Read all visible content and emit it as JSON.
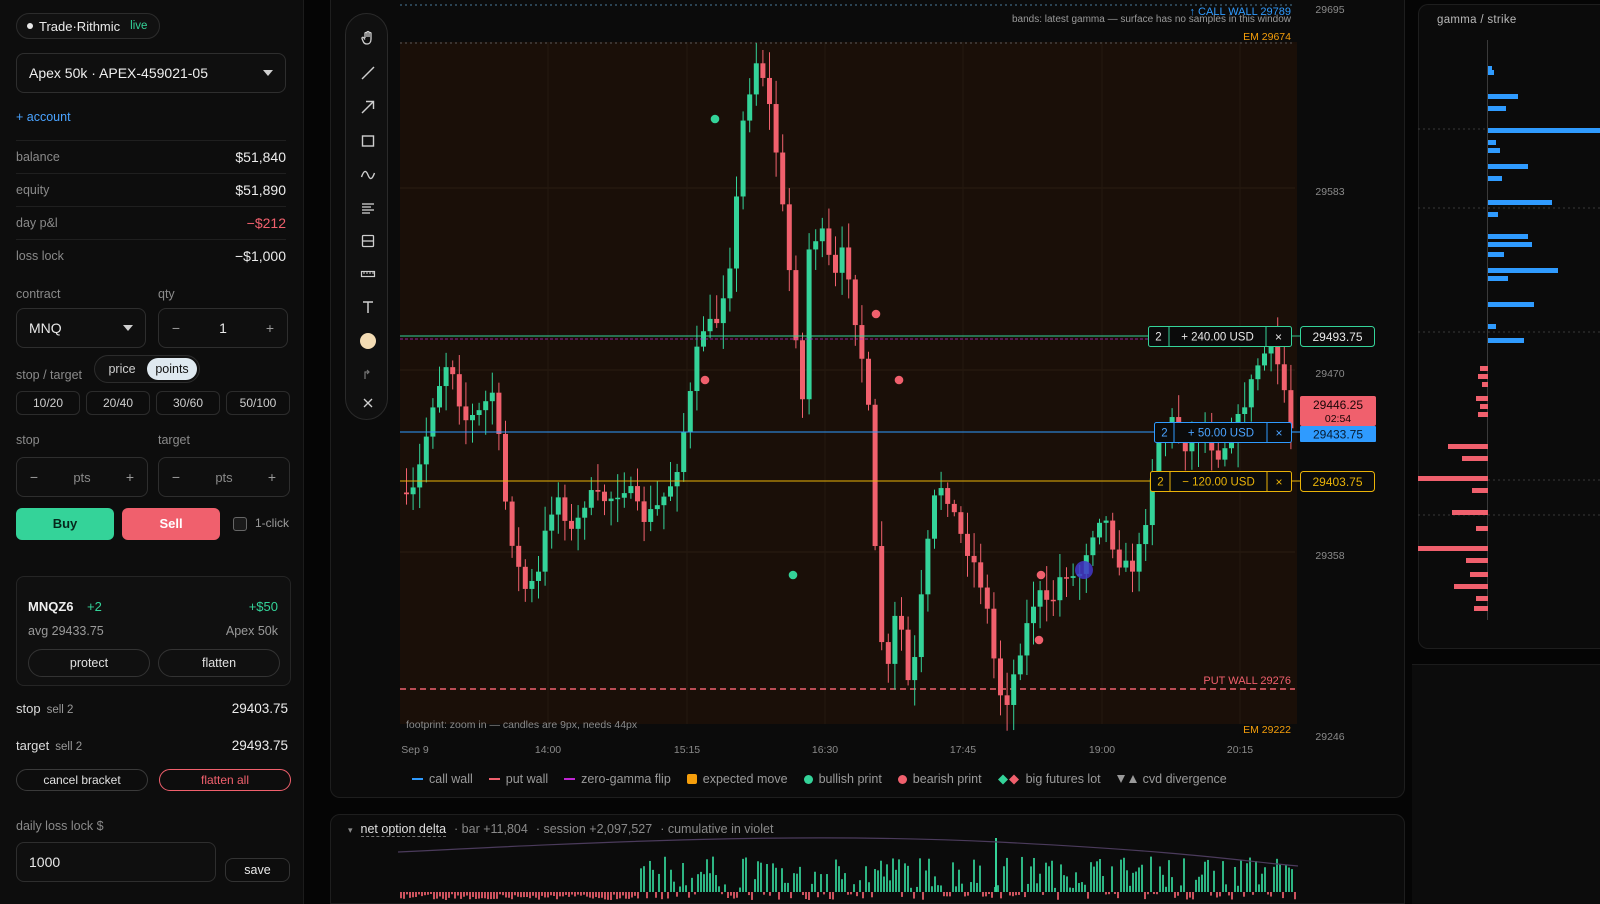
{
  "account_panel": {
    "broker": "Trade·Rithmic",
    "status": "live",
    "account_selected": "Apex 50k · APEX-459021-05",
    "add_account": "+ account",
    "stats": [
      {
        "label": "balance",
        "value": "$51,840",
        "negative": false
      },
      {
        "label": "equity",
        "value": "$51,890",
        "negative": false
      },
      {
        "label": "day p&l",
        "value": "−$212",
        "negative": true
      },
      {
        "label": "loss lock",
        "value": "−$1,000",
        "negative": false
      }
    ]
  },
  "order_ticket": {
    "contract_label": "contract",
    "contract_value": "MNQ",
    "qty_label": "qty",
    "qty_value": "1",
    "stop_target_label": "stop / target",
    "mode_price": "price",
    "mode_points": "points",
    "presets": [
      "10/20",
      "20/40",
      "30/60",
      "50/100"
    ],
    "stop_label": "stop",
    "target_label": "target",
    "stop_placeholder": "pts",
    "target_placeholder": "pts",
    "buy": "Buy",
    "sell": "Sell",
    "one_click": "1-click"
  },
  "position": {
    "symbol": "MNQZ6",
    "qty": "+2",
    "pnl": "+$50",
    "avg": "avg 29433.75",
    "account": "Apex 50k",
    "protect": "protect",
    "flatten": "flatten"
  },
  "orders": [
    {
      "kind": "stop",
      "side": "sell 2",
      "price": "29403.75"
    },
    {
      "kind": "target",
      "side": "sell 2",
      "price": "29493.75"
    }
  ],
  "order_actions": {
    "cancel_bracket": "cancel bracket",
    "flatten_all": "flatten all"
  },
  "daily_loss": {
    "label": "daily loss lock $",
    "value": "1000",
    "save": "save"
  },
  "tools": [
    "hand-icon",
    "line-icon",
    "arrow-icon",
    "rectangle-icon",
    "curve-icon",
    "text-lines-icon",
    "panel-icon",
    "ruler-icon",
    "text-icon",
    "color-icon",
    "undo-icon",
    "close-icon"
  ],
  "chart": {
    "status_note": "bands: latest gamma — surface has no samples in this window",
    "footprint_note": "footprint: zoom in — candles are 9px, needs 44px",
    "call_wall_label": "↑ CALL WALL 29789",
    "em_high_label": "EM 29674",
    "put_wall_label": "PUT WALL 29276",
    "em_low_label": "EM 29222",
    "price_ticks": [
      "29695",
      "29583",
      "29470",
      "29358",
      "29246"
    ],
    "time_ticks": [
      "Sep 9",
      "14:00",
      "15:15",
      "16:30",
      "17:45",
      "19:00",
      "20:15"
    ],
    "current_price": "29446.25",
    "countdown": "02:54",
    "orders": [
      {
        "qty": "2",
        "pnl": "+ 240.00 USD",
        "price": "29493.75",
        "color": "#34d399"
      },
      {
        "qty": "2",
        "pnl": "+ 50.00 USD",
        "price": "29433.75",
        "color": "#2f9bff"
      },
      {
        "qty": "2",
        "pnl": "− 120.00 USD",
        "price": "29403.75",
        "color": "#eab308"
      }
    ],
    "close_symbol": "×"
  },
  "legend": [
    {
      "label": "call wall",
      "kind": "line",
      "color": "#2f9bff"
    },
    {
      "label": "put wall",
      "kind": "line",
      "color": "#f0606d"
    },
    {
      "label": "zero-gamma flip",
      "kind": "line",
      "color": "#c026d3"
    },
    {
      "label": "expected move",
      "kind": "square",
      "color": "#f59e0b"
    },
    {
      "label": "bullish print",
      "kind": "dot",
      "color": "#34d399"
    },
    {
      "label": "bearish print",
      "kind": "dot",
      "color": "#f0606d"
    },
    {
      "label": "big futures lot",
      "kind": "diamonds",
      "color": "#34d399"
    },
    {
      "label": "cvd divergence",
      "kind": "triangles",
      "color": "#9a9a9a"
    }
  ],
  "delta": {
    "title": "net option delta",
    "bar": "· bar +11,804",
    "session": "· session +2,097,527",
    "cumulative": "· cumulative in violet"
  },
  "gamma": {
    "title": "gamma / strike"
  },
  "colors": {
    "bull": "#34d399",
    "bear": "#f0606d",
    "accent": "#2f9bff"
  }
}
